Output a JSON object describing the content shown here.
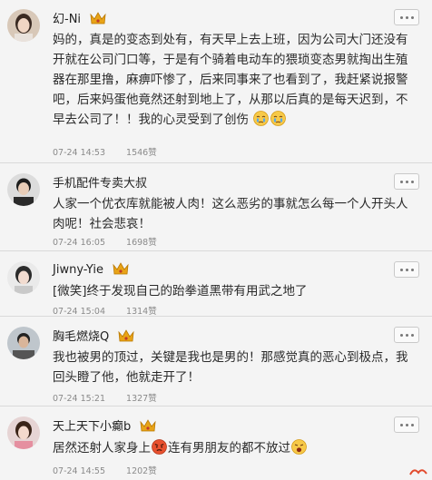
{
  "comments": [
    {
      "username": "幻-Ni",
      "avatar_icon": "user-avatar-woman",
      "crown_icon": "vip-crown-icon",
      "text_line1": "妈的，真是的变态到处有，有天早上去上班，因为公司大门还没有开就在公司门口等，于是有个骑着电动车的猥琐变态男就掏出生殖器在那里撸，麻痹吓惨了，后来同事来了也看到了，我赶紧说报警吧，后来妈蛋他竟然还射到地上了，从那以后真的是每天迟到，不早去公司了！！我的心灵受到了创伤",
      "emoji": [
        "crying-face-emoji",
        "crying-face-emoji"
      ],
      "time": "07-24 14:53",
      "likes": "1546赞"
    },
    {
      "username": "手机配件专卖大叔",
      "avatar_icon": "user-avatar-man",
      "text_line1": "人家一个优衣库就能被人肉！这么恶劣的事就怎么每一个人开头人肉呢！社会悲哀！",
      "time": "07-24 16:05",
      "likes": "1698赞"
    },
    {
      "username": "Jiwny-Yie",
      "avatar_icon": "user-avatar-girl",
      "crown_icon": "vip-crown-icon",
      "text_line1": "[微笑]终于发现自己的跆拳道黑带有用武之地了",
      "time": "07-24 15:04",
      "likes": "1314赞"
    },
    {
      "username": "胸毛燃烧Q",
      "avatar_icon": "user-avatar-man-dark",
      "crown_icon": "vip-crown-icon",
      "text_line1": "我也被男的顶过，关键是我也是男的！那感觉真的恶心到极点，我回头瞪了他，他就走开了！",
      "time": "07-24 15:21",
      "likes": "1327赞"
    },
    {
      "username": "天上天下小癫b",
      "avatar_icon": "user-avatar-girl-pink",
      "crown_icon": "vip-crown-icon",
      "text_before_emoji": "居然还射人家身上",
      "emoji_mid": "angry-face-emoji",
      "text_after_emoji": "连有男朋友的都不放过",
      "emoji_end": "shouting-face-emoji",
      "time": "07-24 14:55",
      "likes": "1202赞"
    }
  ],
  "colors": {
    "background": "#f4f4f4",
    "divider": "#d9d9d9",
    "crown": "#e8a317",
    "meta_text": "#8a8a8a"
  }
}
